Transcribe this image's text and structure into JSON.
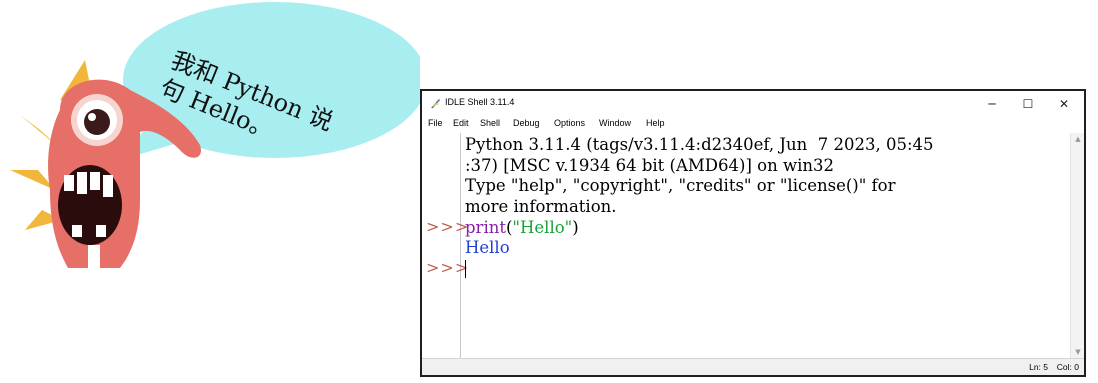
{
  "illustration": {
    "bubble_lines": [
      "我和 Python 说",
      "句 Hello。"
    ],
    "colors": {
      "bubble": "#a8eef1",
      "monster_body": "#e66f68",
      "monster_spikes": "#f0b73a"
    }
  },
  "window": {
    "title": "IDLE Shell 3.11.4",
    "controls": {
      "minimize": "─",
      "maximize": "☐",
      "close": "✕"
    },
    "menu": [
      "File",
      "Edit",
      "Shell",
      "Debug",
      "Options",
      "Window",
      "Help"
    ]
  },
  "shell": {
    "banner_lines": [
      "Python 3.11.4 (tags/v3.11.4:d2340ef, Jun  7 2023, 05:45",
      ":37) [MSC v.1934 64 bit (AMD64)] on win32",
      "Type \"help\", \"copyright\", \"credits\" or \"license()\" for",
      "more information."
    ],
    "prompt": ">>>",
    "command": {
      "func": "print",
      "open": "(",
      "string": "\"Hello\"",
      "close": ")"
    },
    "output": "Hello"
  },
  "status": {
    "line": "Ln: 5",
    "col": "Col: 0"
  }
}
